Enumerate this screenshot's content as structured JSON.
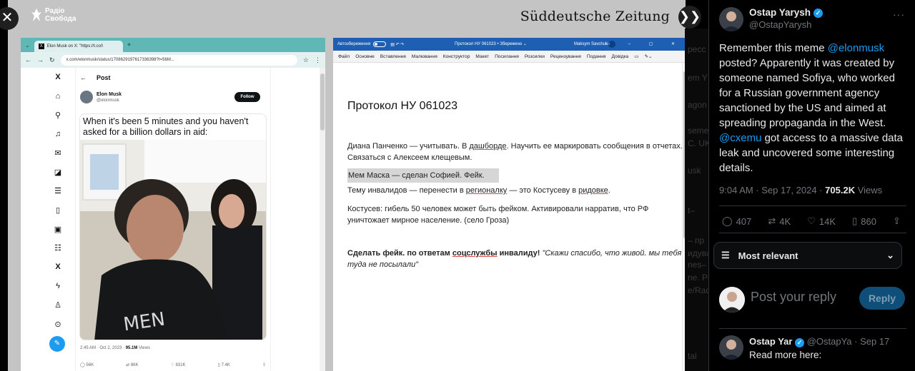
{
  "viewer": {
    "close_glyph": "✕",
    "next_glyph": "❯❯",
    "radio_logo_line1": "Радіо",
    "radio_logo_line2": "Свобода",
    "sz_logo": "Süddeutsche Zeitung"
  },
  "browser": {
    "tab_title": "Elon Musk on X: \"https://t.co/\\",
    "new_tab": "+",
    "url": "x.com/elonmusk/status/1708629197617336398?t=56M...",
    "post_header": "Post",
    "author_name": "Elon Musk",
    "author_handle": "@elonmusk",
    "follow_label": "Follow",
    "meme_caption": "When it's been 5 minutes and you haven't asked for a billion dollars in aid:",
    "post_time": "2:45 AM · Oct 2, 2023 · ",
    "post_views": "95.1M",
    "post_views_label": " Views",
    "actions": [
      "56K",
      "86K",
      "831K",
      "7.4K"
    ]
  },
  "word": {
    "autosave_label": "Автозбереження",
    "doc_title": "Протокол НУ 061023 • Збережено ⌄",
    "user_name": "Maksym Savchuk",
    "menu": [
      "Файл",
      "Основне",
      "Вставлення",
      "Малювання",
      "Конструктор",
      "Макет",
      "Посилання",
      "Розсилки",
      "Рецензування",
      "Подання",
      "Довідка"
    ],
    "heading": "Протокол НУ 061023",
    "p1_a": "Диана Панченко — учитывать. В ",
    "p1_link": "дашборде",
    "p1_b": ". Научить ее маркировать сообщения в отчетах. Связаться с Алексеем клещевым.",
    "p2": "Мем Маска — сделан Софией. Фейк.",
    "p3_a": "Тему инвалидов — перенести в ",
    "p3_link1": "регионалку",
    "p3_b": " — это Костусеву в ",
    "p3_link2": "ридовке",
    "p3_c": ".",
    "p4": "Костусев: гибель 50 человек может быть фейком. Активировали нарратив, что РФ уничтожает мирное население. (село Гроза)",
    "p5_a": "Сделать фейк. по ответам ",
    "p5_link": "соцслужбы",
    "p5_b": " инвалиду! ",
    "p5_quote": "\"Скажи спасибо, что живой. мы тебя туда не посылали\""
  },
  "ghost_text": [
    "ресс",
    "em Y",
    "agon o",
    "seme",
    "C. UK",
    "usk",
    "t–",
    "– пр",
    "идува",
    "nes–",
    "ne. Pr",
    "e/Rad",
    "tal"
  ],
  "tweet": {
    "name": "Ostap Yarysh",
    "handle": "@OstapYarysh",
    "more": "···",
    "text_1": "Remember this meme ",
    "mention_1": "@elonmusk",
    "text_2": " posted? Apparently it was created by someone named Sofiya, who worked for a Russian government agency sanctioned by the US and aimed at spreading propaganda in the West. ",
    "mention_2": "@cxemu",
    "text_3": " got access to a massive data leak and uncovered some interesting details.",
    "time": "9:04 AM · Sep 17, 2024 · ",
    "views": "705.2K",
    "views_label": " Views",
    "replies": "407",
    "reposts": "4K",
    "likes": "14K",
    "bookmarks": "860",
    "sort_label": "Most relevant",
    "reply_placeholder": "Post your reply",
    "reply_button": "Reply",
    "reply2_name": "Ostap Yar",
    "reply2_handle": "@OstapYa · Sep 17",
    "reply2_text": "Read more here:"
  },
  "colors": {
    "accent": "#1d9bf0",
    "word_blue": "#1e5fb3",
    "browser_teal": "#5fb8b6"
  }
}
